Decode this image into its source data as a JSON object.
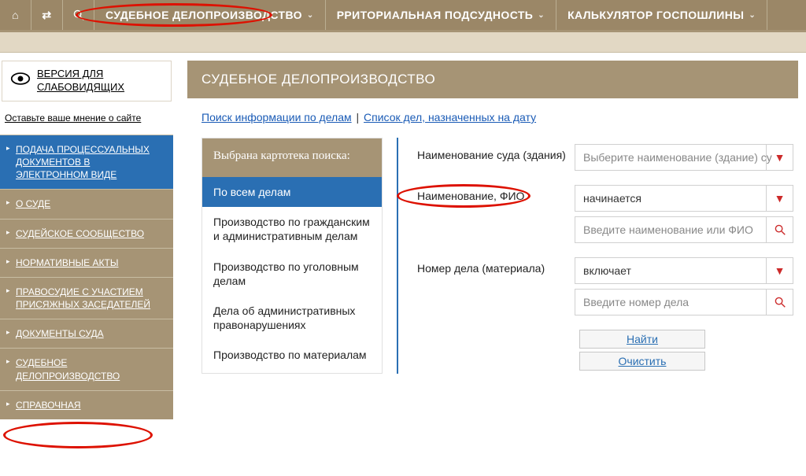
{
  "topnav": {
    "items": [
      {
        "label": "СУДЕБНОЕ ДЕЛОПРОИЗВОДСТВО"
      },
      {
        "label": "РРИТОРИАЛЬНАЯ ПОДСУДНОСТЬ"
      },
      {
        "label": "КАЛЬКУЛЯТОР ГОСПОШЛИНЫ"
      }
    ]
  },
  "a11y_line1": "ВЕРСИЯ ДЛЯ",
  "a11y_line2": "СЛАБОВИДЯЩИХ",
  "feedback": "Оставьте ваше мнение о сайте",
  "sidebar": [
    {
      "label": "ПОДАЧА ПРОЦЕССУАЛЬНЫХ ДОКУМЕНТОВ В ЭЛЕКТРОННОМ ВИДЕ",
      "active": true
    },
    {
      "label": "О СУДЕ"
    },
    {
      "label": "СУДЕЙСКОЕ СООБЩЕСТВО"
    },
    {
      "label": "НОРМАТИВНЫЕ АКТЫ"
    },
    {
      "label": "ПРАВОСУДИЕ С УЧАСТИЕМ ПРИСЯЖНЫХ ЗАСЕДАТЕЛЕЙ"
    },
    {
      "label": "ДОКУМЕНТЫ СУДА"
    },
    {
      "label": "СУДЕБНОЕ ДЕЛОПРОИЗВОДСТВО"
    },
    {
      "label": "СПРАВОЧНАЯ"
    }
  ],
  "content_header": "СУДЕБНОЕ ДЕЛОПРОИЗВОДСТВО",
  "toplinks": {
    "link1": "Поиск информации по делам",
    "link2": "Список дел, назначенных на дату"
  },
  "cardbrowser": {
    "heading": "Выбрана картотека поиска:",
    "options": [
      "По всем делам",
      "Производство по гражданским и административным делам",
      "Производство по уголовным делам",
      "Дела об административных правонарушениях",
      "Производство по материалам"
    ]
  },
  "form": {
    "row1": {
      "label": "Наименование суда (здания)",
      "placeholder": "Выберите наименование (здание) су"
    },
    "row2": {
      "label": "Наименование, ФИО",
      "select_value": "начинается",
      "placeholder": "Введите наименование или ФИО"
    },
    "row3": {
      "label": "Номер дела (материала)",
      "select_value": "включает",
      "placeholder": "Введите номер дела"
    },
    "btn_search": "Найти",
    "btn_clear": "Очистить"
  }
}
